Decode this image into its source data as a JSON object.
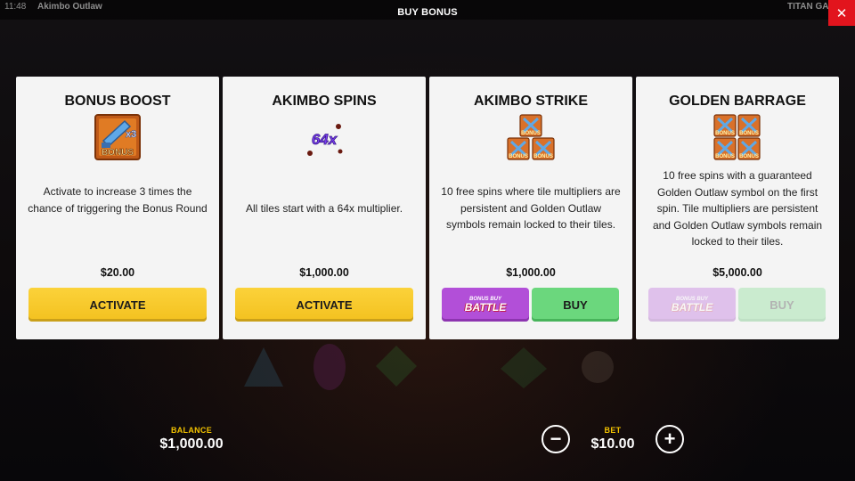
{
  "topbar": {
    "time": "11:48",
    "game_name": "Akimbo Outlaw",
    "provider": "TITAN GA"
  },
  "modal": {
    "title": "BUY BONUS",
    "close_icon": "close-icon"
  },
  "cards": [
    {
      "title": "BONUS BOOST",
      "icon": "bonus-boost-icon",
      "icon_text": [
        "x3",
        "BONUS"
      ],
      "description": "Activate to increase 3 times the chance of triggering the Bonus Round",
      "price": "$20.00",
      "button": "ACTIVATE"
    },
    {
      "title": "AKIMBO SPINS",
      "icon": "multiplier-64x-icon",
      "icon_text": [
        "64x"
      ],
      "description": "All tiles start with a 64x multiplier.",
      "price": "$1,000.00",
      "button": "ACTIVATE"
    },
    {
      "title": "AKIMBO STRIKE",
      "icon": "three-bonus-tiles-icon",
      "icon_text": [
        "BONUS"
      ],
      "description": "10 free spins where tile multipliers are persistent and Golden Outlaw symbols remain locked to their tiles.",
      "price": "$1,000.00",
      "battle_button": {
        "small": "BONUS BUY",
        "big": "BATTLE"
      },
      "button": "BUY"
    },
    {
      "title": "GOLDEN BARRAGE",
      "icon": "four-bonus-tiles-icon",
      "icon_text": [
        "BONUS"
      ],
      "description": "10 free spins with a guaranteed Golden Outlaw symbol on the first spin. Tile multipliers are persistent and Golden Outlaw symbols remain locked to their tiles.",
      "price": "$5,000.00",
      "battle_button": {
        "small": "BONUS BUY",
        "big": "BATTLE"
      },
      "button": "BUY",
      "disabled": true
    }
  ],
  "footer": {
    "balance_label": "BALANCE",
    "balance_value": "$1,000.00",
    "bet_label": "BET",
    "bet_value": "$10.00",
    "minus_icon": "minus-icon",
    "plus_icon": "plus-icon"
  },
  "colors": {
    "accent_yellow": "#F5C526",
    "buy_green": "#6BD77D",
    "battle_purple": "#B24FD8",
    "close_red": "#E2141D",
    "label_gold": "#F2C200"
  }
}
